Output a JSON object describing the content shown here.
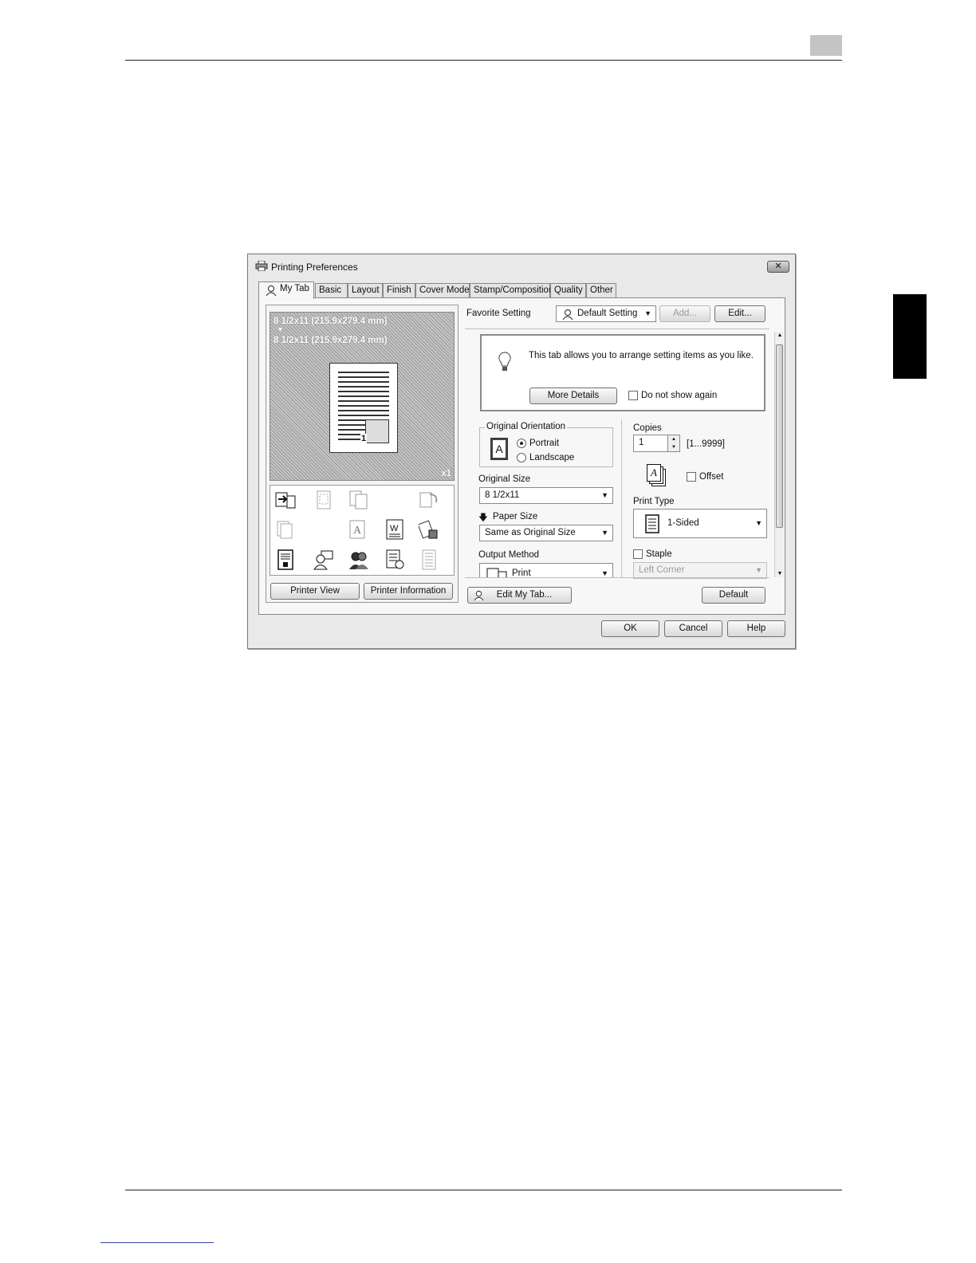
{
  "dialog": {
    "title": "Printing Preferences",
    "close_label": "✕",
    "tabs": [
      {
        "label": "My Tab"
      },
      {
        "label": "Basic"
      },
      {
        "label": "Layout"
      },
      {
        "label": "Finish"
      },
      {
        "label": "Cover Mode"
      },
      {
        "label": "Stamp/Composition"
      },
      {
        "label": "Quality"
      },
      {
        "label": "Other"
      }
    ],
    "preview": {
      "original_size_text": "8 1/2x11 (215.9x279.4 mm)",
      "arrow": "▼",
      "paper_size_text": "8 1/2x11 (215.9x279.4 mm)",
      "page_number": "1",
      "copies_badge": "x1"
    },
    "left_buttons": {
      "printer_view": "Printer View",
      "printer_information": "Printer Information"
    },
    "favorite": {
      "label": "Favorite Setting",
      "value": "Default Setting",
      "add": "Add...",
      "edit": "Edit..."
    },
    "info": {
      "message": "This tab allows you to arrange setting items as you like.",
      "more_details": "More Details",
      "do_not_show": "Do not show again"
    },
    "orientation": {
      "label": "Original Orientation",
      "icon_letter": "A",
      "portrait": "Portrait",
      "landscape": "Landscape"
    },
    "original_size": {
      "label": "Original Size",
      "value": "8 1/2x11"
    },
    "paper_size": {
      "label": "Paper Size",
      "value": "Same as Original Size"
    },
    "output_method": {
      "label": "Output Method",
      "value": "Print"
    },
    "copies": {
      "label": "Copies",
      "value": "1",
      "range": "[1...9999]",
      "icon_letter": "A",
      "offset": "Offset"
    },
    "print_type": {
      "label": "Print Type",
      "value": "1-Sided"
    },
    "staple": {
      "label": "Staple",
      "value": "Left Corner"
    },
    "edit_my_tab": "Edit My Tab...",
    "default": "Default",
    "ok": "OK",
    "cancel": "Cancel",
    "help": "Help"
  }
}
